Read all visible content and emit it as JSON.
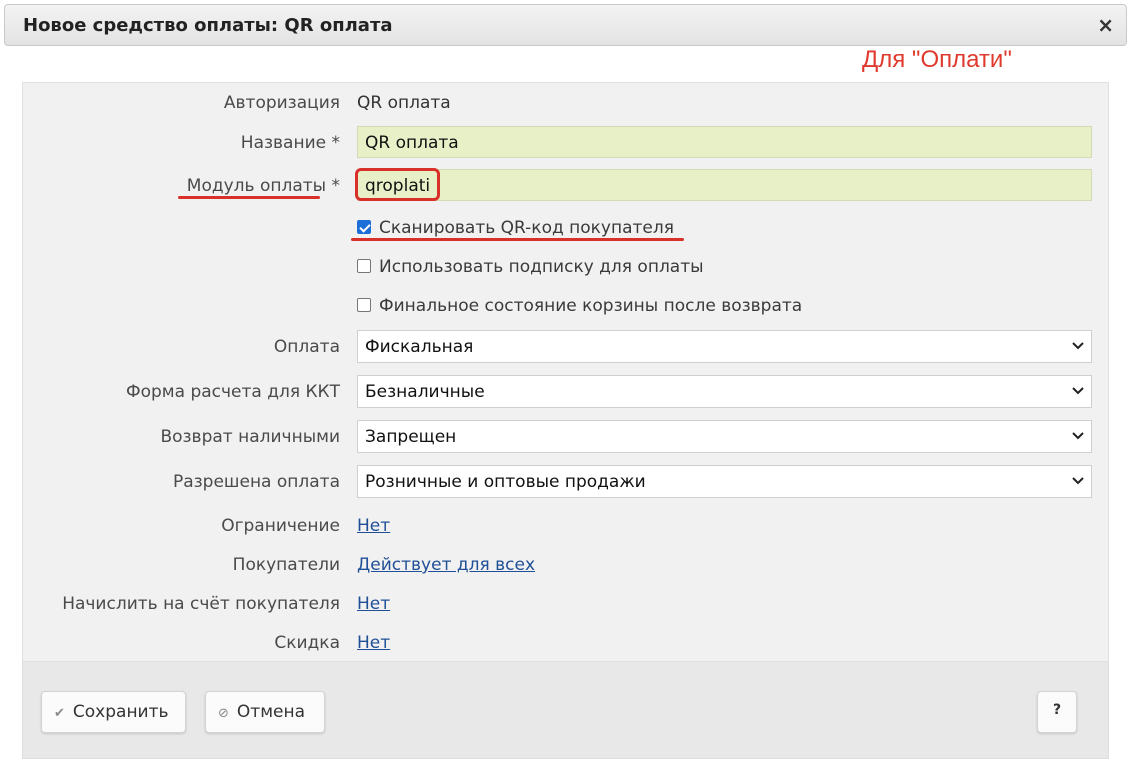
{
  "window": {
    "title": "Новое средство оплаты: QR оплата",
    "close_glyph": "×"
  },
  "annotation": {
    "text": "Для \"Оплати\"",
    "color": "#e03a2e"
  },
  "form": {
    "authorization": {
      "label": "Авторизация",
      "value": "QR оплата"
    },
    "name": {
      "label": "Название *",
      "value": "QR оплата"
    },
    "module": {
      "label": "Модуль оплаты *",
      "value": "qroplati"
    },
    "checkboxes": [
      {
        "label": "Сканировать QR-код покупателя",
        "checked": true
      },
      {
        "label": "Использовать подписку для оплаты",
        "checked": false
      },
      {
        "label": "Финальное состояние корзины после возврата",
        "checked": false
      }
    ],
    "payment": {
      "label": "Оплата",
      "value": "Фискальная"
    },
    "kkt_form": {
      "label": "Форма расчета для ККТ",
      "value": "Безналичные"
    },
    "cash_refund": {
      "label": "Возврат наличными",
      "value": "Запрещен"
    },
    "allowed_payment": {
      "label": "Разрешена оплата",
      "value": "Розничные и оптовые продажи"
    },
    "restriction": {
      "label": "Ограничение",
      "value": "Нет"
    },
    "buyers": {
      "label": "Покупатели",
      "value": "Действует для всех"
    },
    "credit_account": {
      "label": "Начислить на счёт покупателя",
      "value": "Нет"
    },
    "discount": {
      "label": "Скидка",
      "value": "Нет"
    }
  },
  "footer": {
    "save_label": "Сохранить",
    "cancel_label": "Отмена",
    "help_label": "?"
  },
  "colors": {
    "accent_red": "#d9302a",
    "input_bg": "#e8f0c8",
    "link": "#1f4f96",
    "checkbox_checked": "#1d6fd8"
  }
}
